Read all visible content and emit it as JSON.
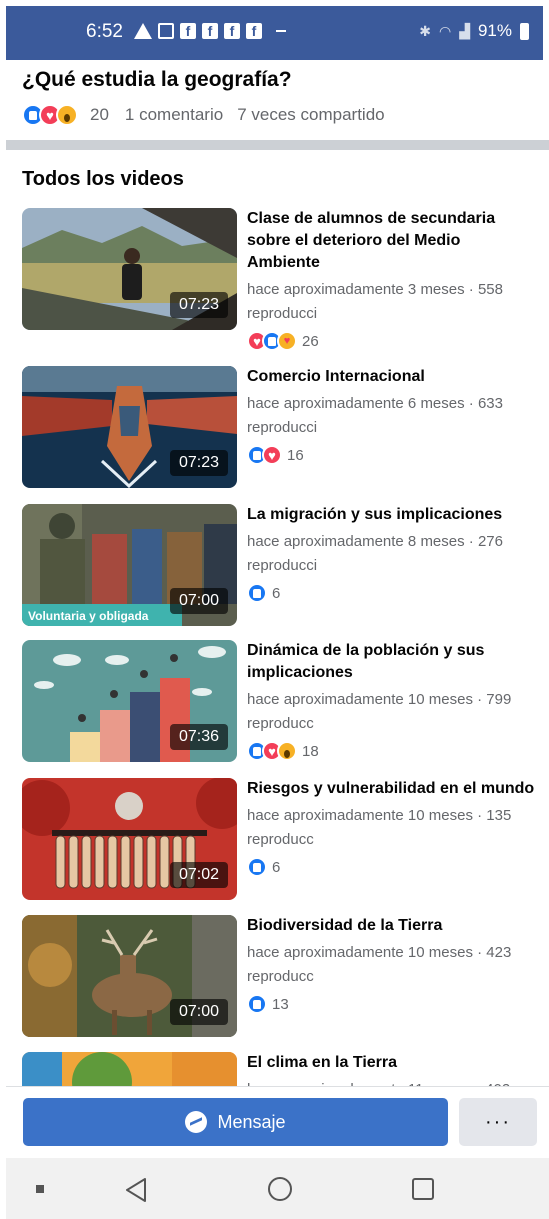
{
  "status_bar": {
    "time": "6:52",
    "battery": "91%"
  },
  "post": {
    "title": "¿Qué estudia la geografía?",
    "reaction_count": "20",
    "comments": "1 comentario",
    "shares": "7 veces compartido"
  },
  "section": {
    "title": "Todos los videos"
  },
  "videos": [
    {
      "title": "Clase de alumnos de secundaria sobre el deterioro del Medio Ambiente",
      "meta": "hace aproximadamente 3 meses · 558 reproducci",
      "duration": "07:23",
      "reaction_count": "26",
      "reactions": [
        "love",
        "like",
        "care"
      ]
    },
    {
      "title": "Comercio Internacional",
      "meta": "hace aproximadamente 6 meses · 633 reproducci",
      "duration": "07:23",
      "reaction_count": "16",
      "reactions": [
        "like",
        "love"
      ]
    },
    {
      "title": "La migración y sus implicaciones",
      "meta": "hace aproximadamente 8 meses · 276 reproducci",
      "duration": "07:00",
      "reaction_count": "6",
      "reactions": [
        "like"
      ],
      "thumb_caption": "Voluntaria y obligada"
    },
    {
      "title": "Dinámica de la población y sus implicaciones",
      "meta": "hace aproximadamente 10 meses · 799 reproducc",
      "duration": "07:36",
      "reaction_count": "18",
      "reactions": [
        "like",
        "love",
        "wow"
      ]
    },
    {
      "title": "Riesgos y vulnerabilidad en el mundo",
      "meta": "hace aproximadamente 10 meses · 135 reproducc",
      "duration": "07:02",
      "reaction_count": "6",
      "reactions": [
        "like"
      ]
    },
    {
      "title": "Biodiversidad de la Tierra",
      "meta": "hace aproximadamente 10 meses · 423 reproducc",
      "duration": "07:00",
      "reaction_count": "13",
      "reactions": [
        "like"
      ]
    },
    {
      "title": "El clima en la Tierra",
      "meta": "hace aproximadamente 11 meses · 402",
      "duration": "",
      "reaction_count": "",
      "reactions": []
    }
  ],
  "actions": {
    "message_label": "Mensaje",
    "more_label": "···"
  },
  "colors": {
    "status_bar": "#3b5a9b",
    "message_button": "#3b72c8",
    "like": "#1877f2",
    "love": "#f33e58",
    "wow": "#f7b125"
  }
}
